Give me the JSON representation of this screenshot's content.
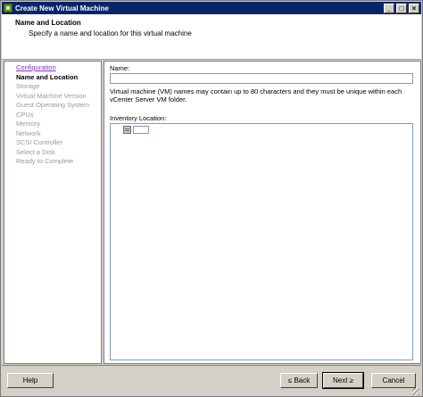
{
  "window": {
    "title": "Create New Virtual Machine",
    "controls": {
      "minimize": "_",
      "maximize": "□",
      "close": "×"
    }
  },
  "header": {
    "title": "Name and Location",
    "description": "Specify a name and location for this virtual machine"
  },
  "steps": [
    {
      "label": "Configuration",
      "state": "link"
    },
    {
      "label": "Name and Location",
      "state": "current"
    },
    {
      "label": "Storage",
      "state": "disabled"
    },
    {
      "label": "Virtual Machine Version",
      "state": "disabled"
    },
    {
      "label": "Guest Operating System",
      "state": "disabled"
    },
    {
      "label": "CPUs",
      "state": "disabled"
    },
    {
      "label": "Memory",
      "state": "disabled"
    },
    {
      "label": "Network",
      "state": "disabled"
    },
    {
      "label": "SCSI Controller",
      "state": "disabled"
    },
    {
      "label": "Select a Disk",
      "state": "disabled"
    },
    {
      "label": "Ready to Complete",
      "state": "disabled"
    }
  ],
  "form": {
    "name_label": "Name:",
    "name_value": "",
    "info_text": "Virtual machine (VM) names may contain up to 80 characters and they must be unique within each vCenter Server VM folder.",
    "inventory_label": "Inventory Location:",
    "tree_root_icon": "datacenter-icon"
  },
  "footer": {
    "help": "Help",
    "back": "≤ Back",
    "next": "Next ≥",
    "cancel": "Cancel"
  },
  "colors": {
    "title_bar": "#0a246a",
    "link": "#7b2fbf",
    "disabled_text": "#9a9a9a"
  }
}
